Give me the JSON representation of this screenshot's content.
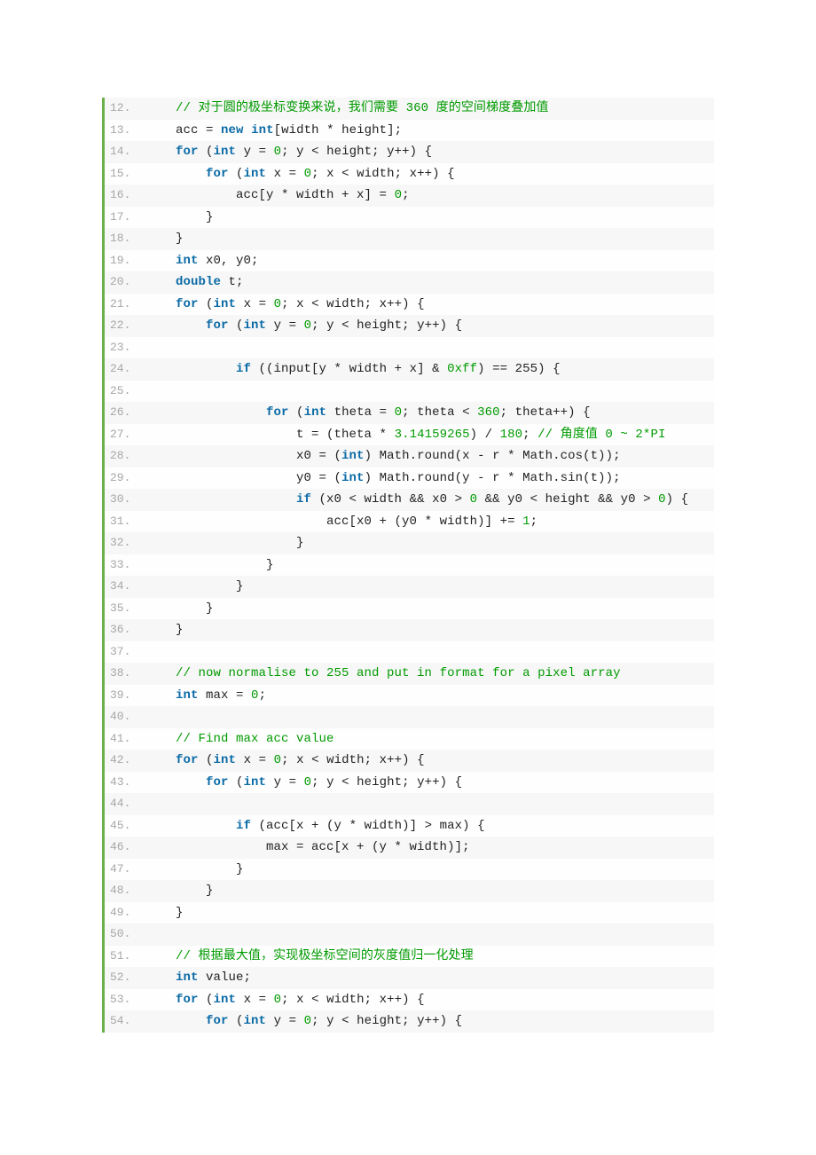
{
  "lines": [
    {
      "n": 12,
      "indent": 1,
      "segs": [
        {
          "t": "// 对于圆的极坐标变换来说，我们需要 360 度的空间梯度叠加值",
          "c": "cmt"
        }
      ]
    },
    {
      "n": 13,
      "indent": 1,
      "segs": [
        {
          "t": "acc = "
        },
        {
          "t": "new",
          "c": "kw"
        },
        {
          "t": " "
        },
        {
          "t": "int",
          "c": "kw"
        },
        {
          "t": "[width * height];"
        }
      ]
    },
    {
      "n": 14,
      "indent": 1,
      "segs": [
        {
          "t": "for",
          "c": "kw"
        },
        {
          "t": " ("
        },
        {
          "t": "int",
          "c": "kw"
        },
        {
          "t": " y = "
        },
        {
          "t": "0",
          "c": "num"
        },
        {
          "t": "; y < height; y++) { "
        }
      ]
    },
    {
      "n": 15,
      "indent": 2,
      "segs": [
        {
          "t": "for",
          "c": "kw"
        },
        {
          "t": " ("
        },
        {
          "t": "int",
          "c": "kw"
        },
        {
          "t": " x = "
        },
        {
          "t": "0",
          "c": "num"
        },
        {
          "t": "; x < width; x++) { "
        }
      ]
    },
    {
      "n": 16,
      "indent": 3,
      "segs": [
        {
          "t": "acc[y * width + x] = "
        },
        {
          "t": "0",
          "c": "num"
        },
        {
          "t": ";"
        }
      ]
    },
    {
      "n": 17,
      "indent": 2,
      "segs": [
        {
          "t": "}"
        }
      ]
    },
    {
      "n": 18,
      "indent": 1,
      "segs": [
        {
          "t": "}"
        }
      ]
    },
    {
      "n": 19,
      "indent": 1,
      "segs": [
        {
          "t": "int",
          "c": "kw"
        },
        {
          "t": " x0, y0;"
        }
      ]
    },
    {
      "n": 20,
      "indent": 1,
      "segs": [
        {
          "t": "double",
          "c": "kw"
        },
        {
          "t": " t;"
        }
      ]
    },
    {
      "n": 21,
      "indent": 1,
      "segs": [
        {
          "t": "for",
          "c": "kw"
        },
        {
          "t": " ("
        },
        {
          "t": "int",
          "c": "kw"
        },
        {
          "t": " x = "
        },
        {
          "t": "0",
          "c": "num"
        },
        {
          "t": "; x < width; x++) { "
        }
      ]
    },
    {
      "n": 22,
      "indent": 2,
      "segs": [
        {
          "t": "for",
          "c": "kw"
        },
        {
          "t": " ("
        },
        {
          "t": "int",
          "c": "kw"
        },
        {
          "t": " y = "
        },
        {
          "t": "0",
          "c": "num"
        },
        {
          "t": "; y < height; y++) { "
        }
      ]
    },
    {
      "n": 23,
      "indent": 0,
      "segs": [
        {
          "t": ""
        }
      ]
    },
    {
      "n": 24,
      "indent": 3,
      "segs": [
        {
          "t": "if",
          "c": "kw"
        },
        {
          "t": " ((input[y * width + x] & "
        },
        {
          "t": "0xff",
          "c": "num"
        },
        {
          "t": ") == 255) { "
        }
      ]
    },
    {
      "n": 25,
      "indent": 0,
      "segs": [
        {
          "t": ""
        }
      ]
    },
    {
      "n": 26,
      "indent": 4,
      "segs": [
        {
          "t": "for",
          "c": "kw"
        },
        {
          "t": " ("
        },
        {
          "t": "int",
          "c": "kw"
        },
        {
          "t": " theta = "
        },
        {
          "t": "0",
          "c": "num"
        },
        {
          "t": "; theta < "
        },
        {
          "t": "360",
          "c": "num"
        },
        {
          "t": "; theta++) { "
        }
      ]
    },
    {
      "n": 27,
      "indent": 5,
      "segs": [
        {
          "t": "t = (theta * "
        },
        {
          "t": "3.14159265",
          "c": "num"
        },
        {
          "t": ") / "
        },
        {
          "t": "180",
          "c": "num"
        },
        {
          "t": "; "
        },
        {
          "t": "// 角度值 0 ~ 2*PI",
          "c": "cmt"
        }
      ]
    },
    {
      "n": 28,
      "indent": 5,
      "segs": [
        {
          "t": "x0 = ("
        },
        {
          "t": "int",
          "c": "kw"
        },
        {
          "t": ") Math.round(x - r * Math.cos(t));"
        }
      ]
    },
    {
      "n": 29,
      "indent": 5,
      "segs": [
        {
          "t": "y0 = ("
        },
        {
          "t": "int",
          "c": "kw"
        },
        {
          "t": ") Math.round(y - r * Math.sin(t));"
        }
      ]
    },
    {
      "n": 30,
      "indent": 5,
      "segs": [
        {
          "t": "if",
          "c": "kw"
        },
        {
          "t": " (x0 < width && x0 > "
        },
        {
          "t": "0",
          "c": "num"
        },
        {
          "t": " && y0 < height && y0 > "
        },
        {
          "t": "0",
          "c": "num"
        },
        {
          "t": ") {"
        }
      ]
    },
    {
      "n": 31,
      "indent": 6,
      "segs": [
        {
          "t": "acc[x0 + (y0 * width)] += "
        },
        {
          "t": "1",
          "c": "num"
        },
        {
          "t": ";"
        }
      ]
    },
    {
      "n": 32,
      "indent": 5,
      "segs": [
        {
          "t": "}"
        }
      ]
    },
    {
      "n": 33,
      "indent": 4,
      "segs": [
        {
          "t": "}"
        }
      ]
    },
    {
      "n": 34,
      "indent": 3,
      "segs": [
        {
          "t": "}"
        }
      ]
    },
    {
      "n": 35,
      "indent": 2,
      "segs": [
        {
          "t": "}"
        }
      ]
    },
    {
      "n": 36,
      "indent": 1,
      "segs": [
        {
          "t": "}"
        }
      ]
    },
    {
      "n": 37,
      "indent": 0,
      "segs": [
        {
          "t": ""
        }
      ]
    },
    {
      "n": 38,
      "indent": 1,
      "segs": [
        {
          "t": "// now normalise to 255 and put in format for a pixel array",
          "c": "cmt"
        }
      ]
    },
    {
      "n": 39,
      "indent": 1,
      "segs": [
        {
          "t": "int",
          "c": "kw"
        },
        {
          "t": " max = "
        },
        {
          "t": "0",
          "c": "num"
        },
        {
          "t": ";"
        }
      ]
    },
    {
      "n": 40,
      "indent": 0,
      "segs": [
        {
          "t": ""
        }
      ]
    },
    {
      "n": 41,
      "indent": 1,
      "segs": [
        {
          "t": "// Find max acc value",
          "c": "cmt"
        }
      ]
    },
    {
      "n": 42,
      "indent": 1,
      "segs": [
        {
          "t": "for",
          "c": "kw"
        },
        {
          "t": " ("
        },
        {
          "t": "int",
          "c": "kw"
        },
        {
          "t": " x = "
        },
        {
          "t": "0",
          "c": "num"
        },
        {
          "t": "; x < width; x++) { "
        }
      ]
    },
    {
      "n": 43,
      "indent": 2,
      "segs": [
        {
          "t": "for",
          "c": "kw"
        },
        {
          "t": " ("
        },
        {
          "t": "int",
          "c": "kw"
        },
        {
          "t": " y = "
        },
        {
          "t": "0",
          "c": "num"
        },
        {
          "t": "; y < height; y++) { "
        }
      ]
    },
    {
      "n": 44,
      "indent": 0,
      "segs": [
        {
          "t": ""
        }
      ]
    },
    {
      "n": 45,
      "indent": 3,
      "segs": [
        {
          "t": "if",
          "c": "kw"
        },
        {
          "t": " (acc[x + (y * width)] > max) {"
        }
      ]
    },
    {
      "n": 46,
      "indent": 4,
      "segs": [
        {
          "t": "max = acc[x + (y * width)];"
        }
      ]
    },
    {
      "n": 47,
      "indent": 3,
      "segs": [
        {
          "t": "}"
        }
      ]
    },
    {
      "n": 48,
      "indent": 2,
      "segs": [
        {
          "t": "}"
        }
      ]
    },
    {
      "n": 49,
      "indent": 1,
      "segs": [
        {
          "t": "}"
        }
      ]
    },
    {
      "n": 50,
      "indent": 0,
      "segs": [
        {
          "t": ""
        }
      ]
    },
    {
      "n": 51,
      "indent": 1,
      "segs": [
        {
          "t": "// 根据最大值，实现极坐标空间的灰度值归一化处理",
          "c": "cmt"
        }
      ]
    },
    {
      "n": 52,
      "indent": 1,
      "segs": [
        {
          "t": "int",
          "c": "kw"
        },
        {
          "t": " value;"
        }
      ]
    },
    {
      "n": 53,
      "indent": 1,
      "segs": [
        {
          "t": "for",
          "c": "kw"
        },
        {
          "t": " ("
        },
        {
          "t": "int",
          "c": "kw"
        },
        {
          "t": " x = "
        },
        {
          "t": "0",
          "c": "num"
        },
        {
          "t": "; x < width; x++) { "
        }
      ]
    },
    {
      "n": 54,
      "indent": 2,
      "segs": [
        {
          "t": "for",
          "c": "kw"
        },
        {
          "t": " ("
        },
        {
          "t": "int",
          "c": "kw"
        },
        {
          "t": " y = "
        },
        {
          "t": "0",
          "c": "num"
        },
        {
          "t": "; y < height; y++) { "
        }
      ]
    }
  ]
}
